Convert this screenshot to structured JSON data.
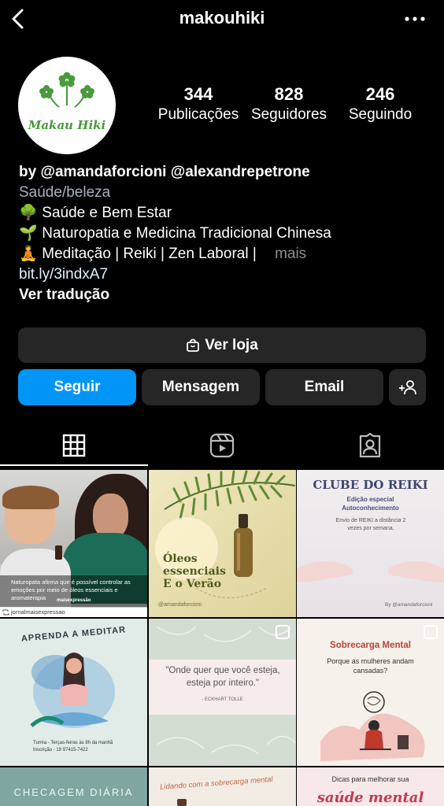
{
  "header": {
    "username": "makouhiki"
  },
  "profile": {
    "logo_text": "Makau Hiki",
    "stats": [
      {
        "count": "344",
        "label": "Publicações"
      },
      {
        "count": "828",
        "label": "Seguidores"
      },
      {
        "count": "246",
        "label": "Seguindo"
      }
    ],
    "bio": {
      "name": "by @amandaforcioni @alexandrepetrone",
      "category": "Saúde/beleza",
      "lines": [
        {
          "emoji": "🌳",
          "text": "Saúde e Bem Estar"
        },
        {
          "emoji": "🌱",
          "text": "Naturopatia e Medicina Tradicional Chinesa"
        },
        {
          "emoji": "🧘",
          "text": "Meditação | Reiki | Zen Laboral |"
        }
      ],
      "more": "mais",
      "link": "bit.ly/3indxA7",
      "translate": "Ver tradução"
    }
  },
  "actions": {
    "shop": "Ver loja",
    "follow": "Seguir",
    "message": "Mensagem",
    "email": "Email",
    "follow_color": "#0095f6"
  },
  "tabs": [
    "grid-icon",
    "reels-icon",
    "tagged-icon"
  ],
  "posts": {
    "p1": {
      "caption": "Naturopata afirma que é possível controlar as emoções por meio de óleos essenciais e aromaterapia",
      "brand": "maisexpressão",
      "repost": "jornalmaisexpressao"
    },
    "p2": {
      "title": "Óleos essenciais E o Verão",
      "handle": "@amandaforcioni"
    },
    "p3": {
      "title": "CLUBE DO REIKI",
      "subtitle": "Edição especial Autoconhecimento",
      "body": "Envio de REIKI a distância 2 vezes por semana.",
      "signature": "By @amandaforcioni"
    },
    "p4": {
      "title": "APRENDA A MEDITAR",
      "line1": "Turma - Terças-feiras às 8h da manhã",
      "line2": "Inscrição - 19 97415-7422"
    },
    "p5": {
      "quote": "\"Onde quer que você esteja, esteja por inteiro.\"",
      "author": "- ECKHART TOLLE"
    },
    "p6": {
      "title": "Sobrecarga Mental",
      "subtitle": "Porque as mulheres andam cansadas?"
    },
    "p7": {
      "title": "CHECAGEM DIÁRIA"
    },
    "p8": {
      "title": "Lidando com a sobrecarga mental"
    },
    "p9": {
      "title1": "Dicas para melhorar sua",
      "title2": "saúde mental"
    }
  }
}
